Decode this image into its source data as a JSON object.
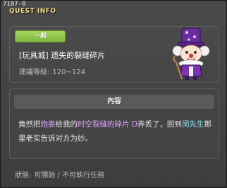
{
  "window": {
    "quest_id": "7107-0",
    "title": "QUEST INFO"
  },
  "quest": {
    "category": "一般",
    "name": "[玩具城] 遗失的裂缝碎片",
    "level_label": "建議等級:",
    "level_range": "120~124"
  },
  "content": {
    "header": "內容",
    "segments": [
      {
        "text": "竟然把",
        "style": "normal"
      },
      {
        "text": "炮娄",
        "style": "purple"
      },
      {
        "text": "给我的",
        "style": "normal"
      },
      {
        "text": "时空裂缝的碎片 D",
        "style": "purple"
      },
      {
        "text": "弄丢了，回到",
        "style": "normal"
      },
      {
        "text": "闵先生",
        "style": "cyan"
      },
      {
        "text": "那里老实告诉对方为妙。",
        "style": "normal"
      }
    ]
  },
  "status": {
    "label": "狀態:",
    "value": "可開始 / 不可執行任務"
  },
  "colors": {
    "title": "#ffe28a",
    "badge_green": "#8cc84a",
    "highlight_purple": "#e3a0ff",
    "highlight_cyan": "#8fe9ff"
  },
  "npc": {
    "icon": "clown-npc-icon"
  }
}
